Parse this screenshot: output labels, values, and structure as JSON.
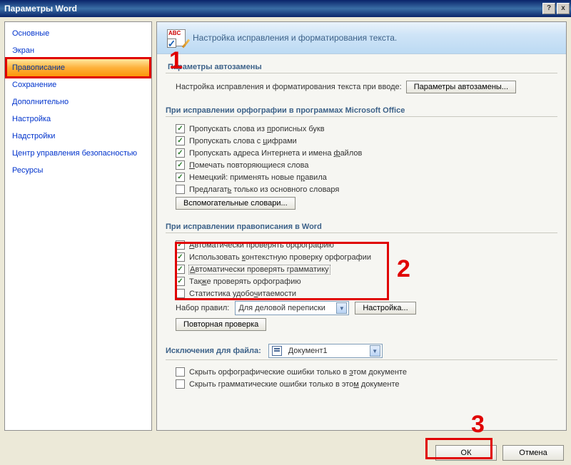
{
  "title": "Параметры Word",
  "titlebar_buttons": {
    "help": "?",
    "close": "x"
  },
  "sidebar": {
    "items": [
      "Основные",
      "Экран",
      "Правописание",
      "Сохранение",
      "Дополнительно",
      "Настройка",
      "Надстройки",
      "Центр управления безопасностью",
      "Ресурсы"
    ],
    "selected_index": 2
  },
  "header": "Настройка исправления и форматирования текста.",
  "s_autocorr": {
    "title": "Параметры автозамены",
    "desc": "Настройка исправления и форматирования текста при вводе:",
    "btn": "Параметры автозамены..."
  },
  "s_office": {
    "title": "При исправлении орфографии в программах Microsoft Office",
    "items": [
      {
        "checked": true,
        "label_pre": "Пропускать слова из ",
        "u": "п",
        "label_post": "рописных букв"
      },
      {
        "checked": true,
        "label_pre": "Пропускать слова с ",
        "u": "ц",
        "label_post": "ифрами"
      },
      {
        "checked": true,
        "label_pre": "Пропускать адреса Интернета и имена ",
        "u": "ф",
        "label_post": "айлов"
      },
      {
        "checked": true,
        "label_pre": "",
        "u": "П",
        "label_post": "омечать повторяющиеся слова"
      },
      {
        "checked": true,
        "label_pre": "Немецкий: применять новые п",
        "u": "р",
        "label_post": "авила"
      },
      {
        "checked": false,
        "label_pre": "Предлагат",
        "u": "ь",
        "label_post": " только из основного словаря"
      }
    ],
    "btn": "Вспомогательные словари..."
  },
  "s_word": {
    "title": "При исправлении правописания в Word",
    "items": [
      {
        "checked": true,
        "label_pre": "",
        "u": "А",
        "label_post": "втоматически проверять орфографию"
      },
      {
        "checked": true,
        "label_pre": "Использовать ",
        "u": "к",
        "label_post": "онтекстную проверку орфографии"
      },
      {
        "checked": true,
        "label_pre": "",
        "u": "А",
        "label_post": "втоматически проверять грамматику",
        "focus": true
      },
      {
        "checked": true,
        "label_pre": "Так",
        "u": "ж",
        "label_post": "е проверять орфографию"
      },
      {
        "checked": false,
        "label_pre": "Статистика удобо",
        "u": "ч",
        "label_post": "итаемости"
      }
    ],
    "rules_label": "Набор правил:",
    "rules_value": "Для деловой переписки",
    "rules_btn": "Настройка...",
    "recheck_btn": "Повторная проверка"
  },
  "s_except": {
    "title": "Исключения для файла:",
    "file": "Документ1",
    "items": [
      {
        "checked": false,
        "label_pre": "Скрыть орфографические ошибки только в ",
        "u": "э",
        "label_post": "том документе"
      },
      {
        "checked": false,
        "label_pre": "Скрыть грамматические ошибки только в это",
        "u": "м",
        "label_post": " документе"
      }
    ]
  },
  "footer": {
    "ok": "ОК",
    "cancel": "Отмена"
  },
  "annotations": {
    "n1": "1",
    "n2": "2",
    "n3": "3"
  }
}
